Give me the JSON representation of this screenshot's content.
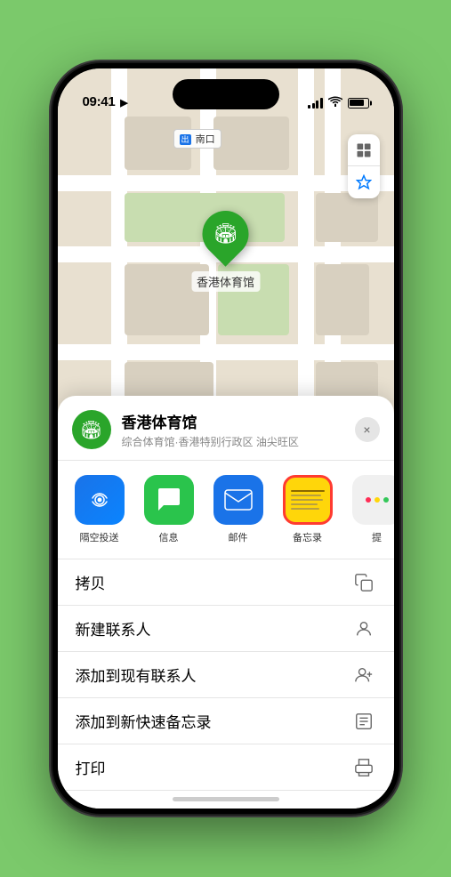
{
  "status": {
    "time": "09:41",
    "location_arrow": "▶"
  },
  "map": {
    "label": "南口",
    "label_prefix": "出"
  },
  "venue": {
    "name": "香港体育馆",
    "description": "综合体育馆·香港特别行政区 油尖旺区",
    "pin_emoji": "🏟"
  },
  "share_items": [
    {
      "id": "airdrop",
      "label": "隔空投送",
      "type": "airdrop"
    },
    {
      "id": "messages",
      "label": "信息",
      "type": "messages"
    },
    {
      "id": "mail",
      "label": "邮件",
      "type": "mail"
    },
    {
      "id": "notes",
      "label": "备忘录",
      "type": "notes"
    },
    {
      "id": "more",
      "label": "提",
      "type": "more"
    }
  ],
  "actions": [
    {
      "id": "copy",
      "label": "拷贝",
      "icon": "copy"
    },
    {
      "id": "new-contact",
      "label": "新建联系人",
      "icon": "person-add"
    },
    {
      "id": "add-existing",
      "label": "添加到现有联系人",
      "icon": "person-plus"
    },
    {
      "id": "quick-note",
      "label": "添加到新快速备忘录",
      "icon": "note"
    },
    {
      "id": "print",
      "label": "打印",
      "icon": "print"
    }
  ],
  "close_label": "×"
}
